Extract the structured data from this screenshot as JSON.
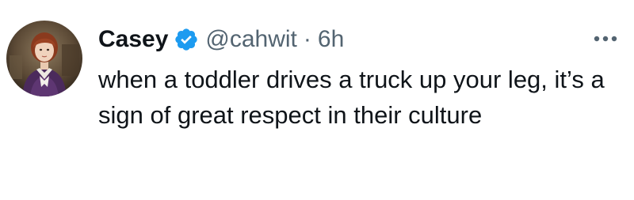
{
  "tweet": {
    "author": {
      "display_name": "Casey",
      "verified_icon": "verified-badge-icon",
      "handle": "@cahwit",
      "avatar": "avatar-portrait"
    },
    "separator": "·",
    "time": "6h",
    "more_icon": "more-options-icon",
    "text": "when a toddler drives a truck up your leg, it’s a sign of great respect in their culture"
  },
  "colors": {
    "text_primary": "#0f1419",
    "text_secondary": "#536471",
    "verified_blue": "#1d9bf0",
    "background": "#ffffff"
  }
}
